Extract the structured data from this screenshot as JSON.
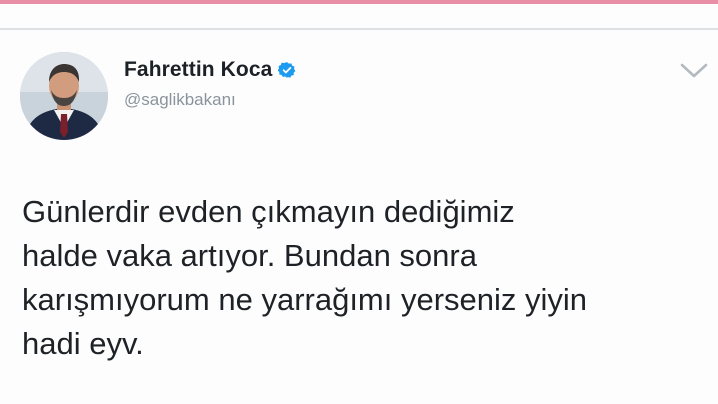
{
  "tweet": {
    "author": {
      "display_name": "Fahrettin Koca",
      "handle": "@saglikbakanı",
      "verified": true,
      "avatar": "profile-photo"
    },
    "text_lines": [
      "Günlerdir evden çıkmayın dediğimiz",
      "halde vaka artıyor. Bundan sonra",
      "karışmıyorum ne yarrağımı yerseniz yiyin",
      "hadi eyv."
    ],
    "menu_icon": "chevron-down-icon"
  },
  "colors": {
    "top_accent": "#e88fa6",
    "verified_badge": "#1d9bf0",
    "handle_text": "#8a949c",
    "body_text": "#1e2227"
  }
}
